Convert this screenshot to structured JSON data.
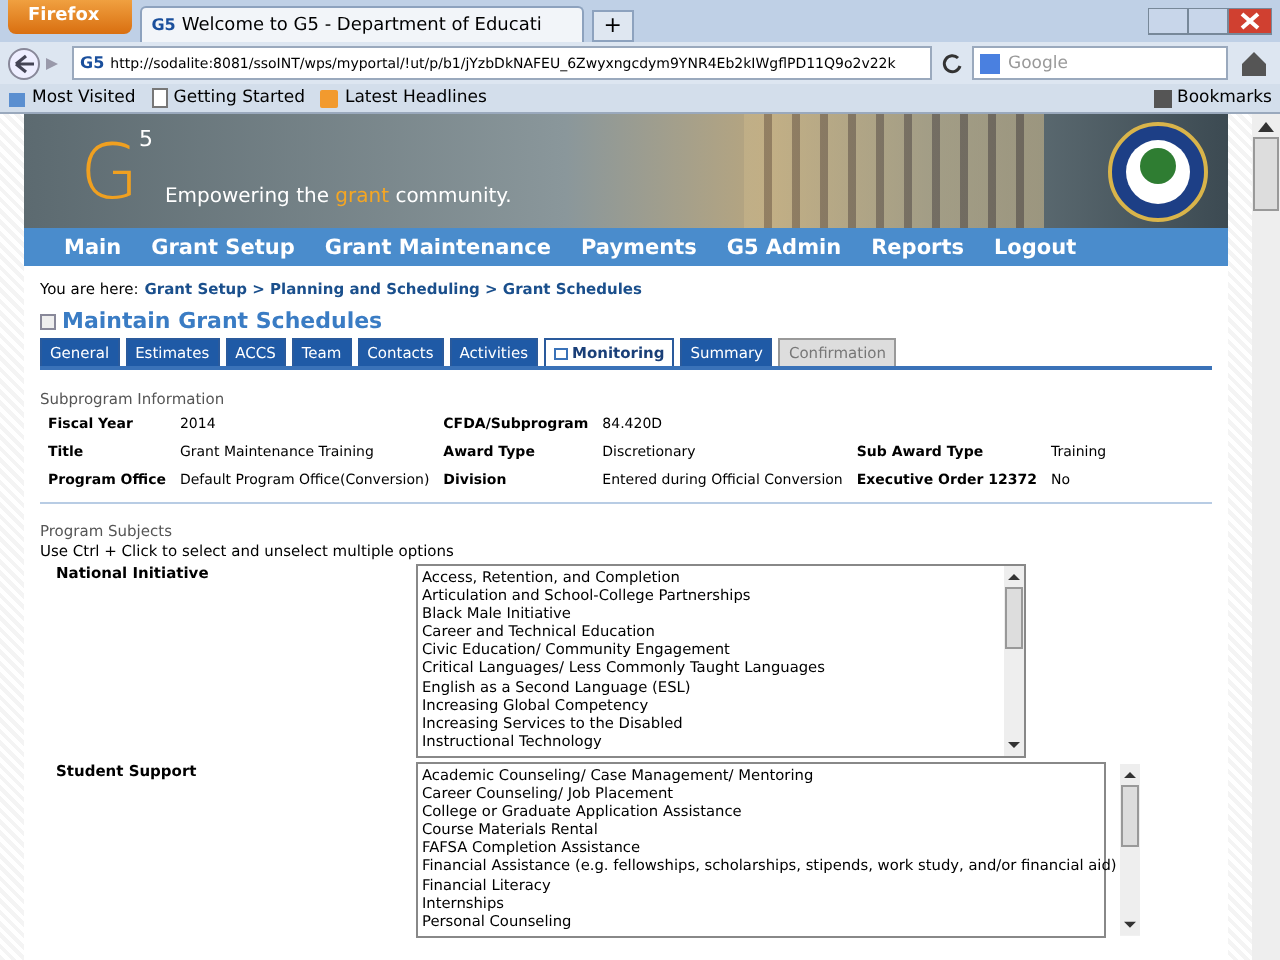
{
  "browser": {
    "menu_button": "Firefox",
    "tab_title": "Welcome to G5 - Department of Educati",
    "tab_logo": "G5",
    "site_logo": "G5",
    "new_tab": "+",
    "url": "http://sodalite:8081/ssoINT/wps/myportal/!ut/p/b1/jYzbDkNAFEU_6Zwyxngcdym9YNR4Eb2kIWgflPD11Q9o2v22k",
    "search_placeholder": "Google",
    "bookmarks": [
      {
        "label": "Most Visited",
        "kind": "folder"
      },
      {
        "label": "Getting Started",
        "kind": "page"
      },
      {
        "label": "Latest Headlines",
        "kind": "feed"
      }
    ],
    "bookmarks_menu": "Bookmarks"
  },
  "banner": {
    "logo_letter": "G",
    "logo_sup": "5",
    "tagline_before": "Empowering the ",
    "tagline_highlight": "grant",
    "tagline_after": " community."
  },
  "nav": [
    "Main",
    "Grant Setup",
    "Grant Maintenance",
    "Payments",
    "G5 Admin",
    "Reports",
    "Logout"
  ],
  "breadcrumb": {
    "prefix": "You are here:",
    "path": "Grant Setup > Planning and Scheduling > Grant Schedules"
  },
  "page_title": "Maintain Grant Schedules",
  "tabs": [
    {
      "label": "General",
      "selected": false,
      "disabled": false
    },
    {
      "label": "Estimates",
      "selected": false,
      "disabled": false
    },
    {
      "label": "ACCS",
      "selected": false,
      "disabled": false
    },
    {
      "label": "Team",
      "selected": false,
      "disabled": false
    },
    {
      "label": "Contacts",
      "selected": false,
      "disabled": false
    },
    {
      "label": "Activities",
      "selected": false,
      "disabled": false
    },
    {
      "label": "Monitoring",
      "selected": true,
      "disabled": false
    },
    {
      "label": "Summary",
      "selected": false,
      "disabled": false
    },
    {
      "label": "Confirmation",
      "selected": false,
      "disabled": true
    }
  ],
  "subprogram": {
    "heading": "Subprogram Information",
    "rows": [
      [
        {
          "label": "Fiscal Year",
          "value": "2014"
        },
        {
          "label": "CFDA/Subprogram",
          "value": "84.420D"
        }
      ],
      [
        {
          "label": "Title",
          "value": "Grant Maintenance Training"
        },
        {
          "label": "Award Type",
          "value": "Discretionary"
        },
        {
          "label": "Sub Award Type",
          "value": "Training"
        }
      ],
      [
        {
          "label": "Program Office",
          "value": "Default Program Office(Conversion)"
        },
        {
          "label": "Division",
          "value": "Entered during Official Conversion"
        },
        {
          "label": "Executive Order 12372",
          "value": "No"
        }
      ]
    ]
  },
  "program_subjects": {
    "heading": "Program Subjects",
    "hint": "Use Ctrl + Click to select and unselect multiple options",
    "lists": [
      {
        "label": "National Initiative",
        "options": [
          "Access, Retention, and Completion",
          "Articulation and School-College Partnerships",
          "Black Male Initiative",
          "Career and Technical Education",
          "Civic Education/ Community Engagement",
          "Critical Languages/ Less Commonly Taught Languages",
          "English as a Second Language (ESL)",
          "Increasing Global Competency",
          "Increasing Services to the Disabled",
          "Instructional Technology"
        ]
      },
      {
        "label": "Student Support",
        "options": [
          "Academic Counseling/ Case Management/ Mentoring",
          "Career Counseling/ Job Placement",
          "College or Graduate Application Assistance",
          "Course Materials Rental",
          "FAFSA Completion Assistance",
          "Financial Assistance (e.g. fellowships, scholarships, stipends, work study, and/or financial aid)",
          "Financial Literacy",
          "Internships",
          "Personal Counseling"
        ]
      }
    ]
  }
}
